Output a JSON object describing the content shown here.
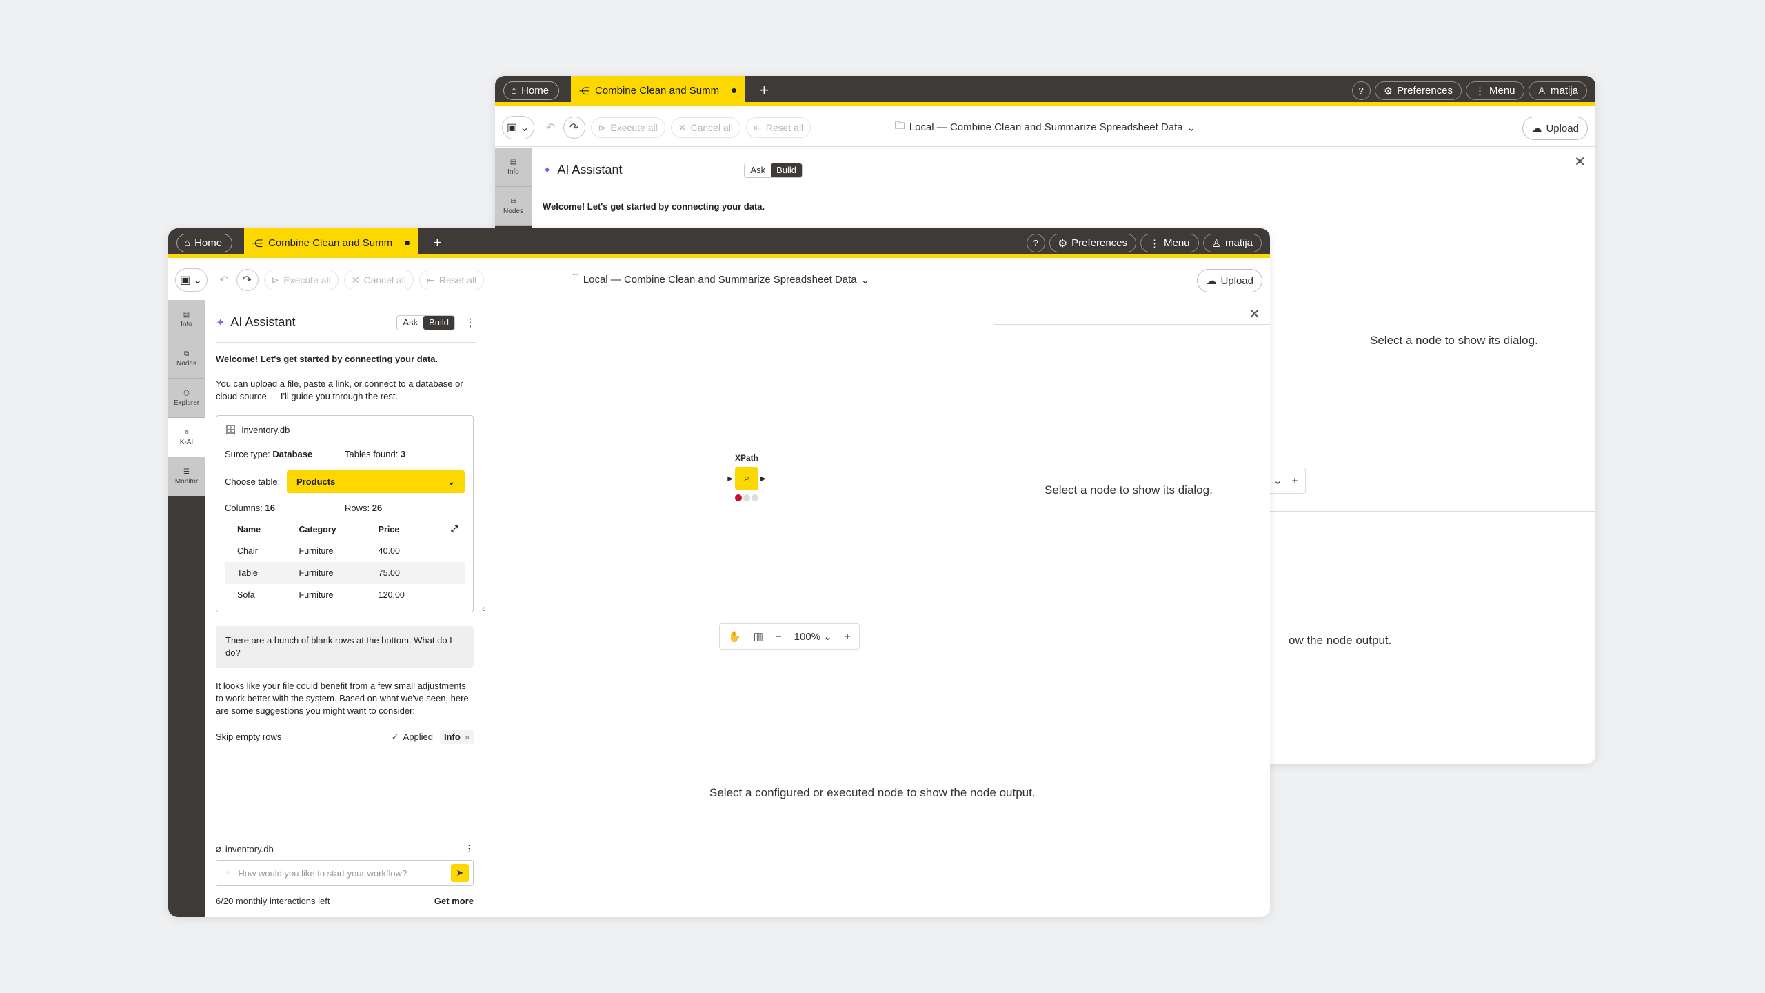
{
  "window_back": {
    "home_tab": "Home",
    "active_tab": "Combine Clean and Summar...",
    "preferences": "Preferences",
    "menu": "Menu",
    "user": "matija",
    "help": "?",
    "toolbar": {
      "execute_all": "Execute all",
      "cancel_all": "Cancel all",
      "reset_all": "Reset all",
      "title": "Local — Combine Clean and Summarize Spreadsheet Data",
      "upload": "Upload"
    },
    "sidebar": [
      {
        "label": "Info"
      },
      {
        "label": "Nodes"
      }
    ],
    "ai": {
      "title": "AI Assistant",
      "ask": "Ask",
      "build": "Build",
      "welcome": "Welcome! Let's get started by connecting your data.",
      "intro_partial": "You can upload a file, paste a link, or connect to a database or"
    },
    "dialog_message": "Select a node to show its dialog.",
    "output_message_partial": "ow the node output."
  },
  "window_front": {
    "home_tab": "Home",
    "active_tab": "Combine Clean and Summar...",
    "preferences": "Preferences",
    "menu": "Menu",
    "user": "matija",
    "help": "?",
    "toolbar": {
      "execute_all": "Execute all",
      "cancel_all": "Cancel all",
      "reset_all": "Reset all",
      "title": "Local — Combine Clean and Summarize Spreadsheet Data",
      "upload": "Upload"
    },
    "sidebar": [
      {
        "label": "Info"
      },
      {
        "label": "Nodes"
      },
      {
        "label": "Explorer"
      },
      {
        "label": "K-AI"
      },
      {
        "label": "Monitor"
      }
    ],
    "ai": {
      "title": "AI Assistant",
      "ask": "Ask",
      "build": "Build",
      "welcome": "Welcome! Let's get started by connecting your data.",
      "intro": "You can upload a file, paste a link, or connect to a database or cloud source — I'll guide you through the rest.",
      "card": {
        "file": "inventory.db",
        "source_label": "Surce type:",
        "source_value": "Database",
        "tables_label": "Tables found:",
        "tables_value": "3",
        "choose_label": "Choose table:",
        "choose_value": "Products",
        "columns_label": "Columns:",
        "columns_value": "16",
        "rows_label": "Rows:",
        "rows_value": "26",
        "headers": [
          "Name",
          "Category",
          "Price"
        ],
        "rows": [
          [
            "Chair",
            "Furniture",
            "40.00"
          ],
          [
            "Table",
            "Furniture",
            "75.00"
          ],
          [
            "Sofa",
            "Furniture",
            "120.00"
          ]
        ]
      },
      "user_message": "There are a bunch of blank rows at the bottom. What do I do?",
      "reply": "It looks like your file could benefit from a few small adjustments to work better with the system. Based on what we've seen, here are some suggestions you might want to consider:",
      "suggestion": "Skip empty rows",
      "applied": "Applied",
      "info": "Info",
      "attachment": "inventory.db",
      "placeholder": "How would you like to start your workflow?",
      "interactions": "6/20 monthly interactions left",
      "get_more": "Get more"
    },
    "node": {
      "name": "XPath"
    },
    "zoom": "100%",
    "dialog_message": "Select a node to show its dialog.",
    "output_message": "Select a configured or executed node to show the node output."
  },
  "colors": {
    "accent": "#fdd800",
    "dark": "#3d3a38",
    "ai": "#8b5cf6"
  }
}
